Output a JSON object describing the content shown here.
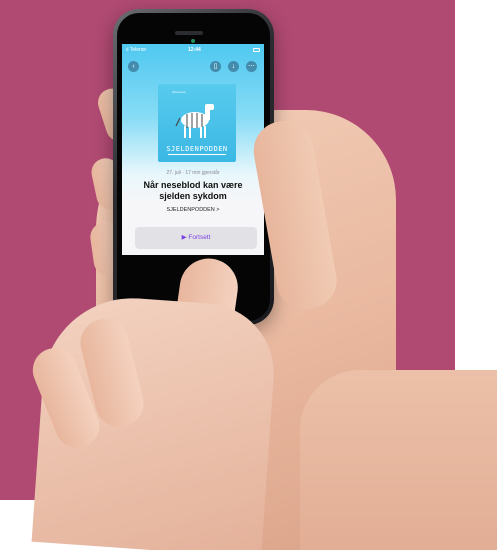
{
  "status_bar": {
    "carrier": "ıl Telenor",
    "time": "12:44"
  },
  "nav": {
    "back_icon": "chevron-left-icon",
    "bookmark_icon": "bookmark-icon",
    "download_icon": "download-icon",
    "more_icon": "more-icon"
  },
  "cover": {
    "brand": "(Ravenus)",
    "title": "SJELDENPODDEN"
  },
  "episode": {
    "meta": "27. juli · 17 min gjenstår",
    "title": "Når neseblod kan være sjelden sykdom",
    "show": "SJELDENPODDEN >"
  },
  "continue_button": {
    "label": "▶ Fortsett"
  },
  "colors": {
    "background": "#b04a72",
    "accent": "#7b3fe4",
    "cover": "#3bb8e4"
  }
}
